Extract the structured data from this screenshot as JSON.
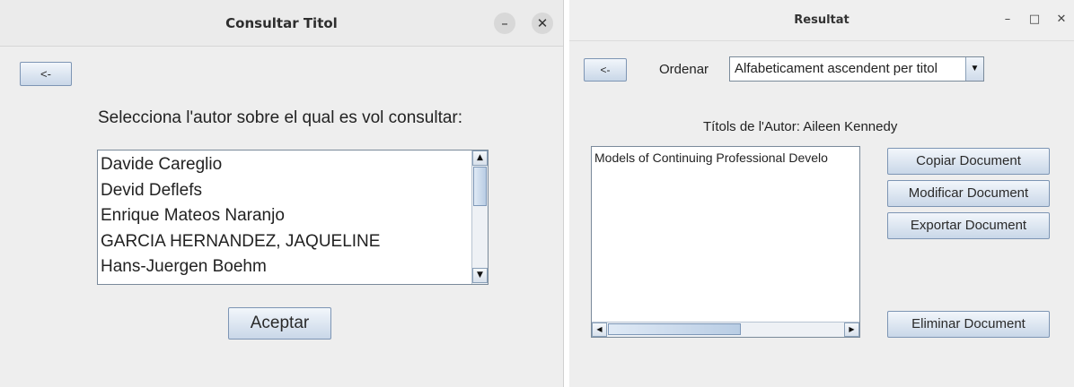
{
  "win1": {
    "title": "Consultar Titol",
    "min_glyph": "–",
    "close_glyph": "✕",
    "back_label": "<-",
    "prompt": "Selecciona l'autor sobre el qual es vol consultar:",
    "authors": [
      "Davide Careglio",
      "Devid Deflefs",
      "Enrique Mateos Naranjo",
      "GARCIA HERNANDEZ, JAQUELINE",
      "Hans-Juergen Boehm"
    ],
    "accept_label": "Aceptar"
  },
  "win2": {
    "title": "Resultat",
    "min_glyph": "–",
    "max_glyph": "□",
    "close_glyph": "✕",
    "back_label": "<-",
    "order_label": "Ordenar",
    "order_value": "Alfabeticament ascendent per titol",
    "author_titles_label": "Títols de l'Autor: Aileen Kennedy",
    "titles": [
      "Models of Continuing Professional Develo"
    ],
    "buttons": {
      "copy": "Copiar Document",
      "modify": "Modificar Document",
      "export": "Exportar Document",
      "delete": "Eliminar Document"
    }
  },
  "icons": {
    "arrow_up": "▲",
    "arrow_down": "▼",
    "arrow_left": "◀",
    "arrow_right": "▶",
    "combo_arrow": "▼"
  }
}
